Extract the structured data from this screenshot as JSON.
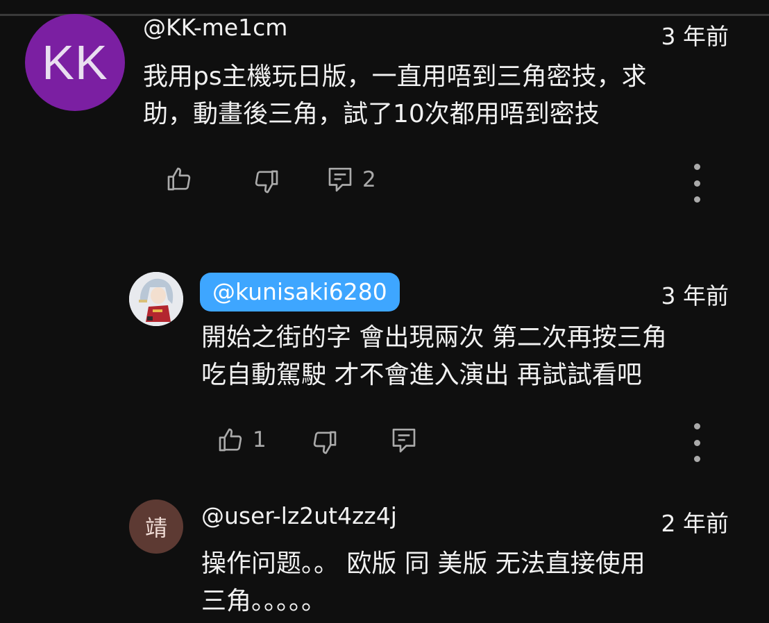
{
  "comments": [
    {
      "avatar_text": "KK",
      "avatar_color": "#7b1fa2",
      "author": "@KK-me1cm",
      "time": "3 年前",
      "lines": [
        "我用ps主機玩日版，一直用唔到三角密技，求",
        "助，動畫後三角，試了10次都用唔到密技"
      ],
      "reply_count": "2"
    },
    {
      "avatar_icon": "anime-character-avatar",
      "author": "@kunisaki6280",
      "author_highlight_color": "#3ea6ff",
      "time": "3 年前",
      "lines": [
        "開始之街的字 會出現兩次 第二次再按三角",
        "吃自動駕駛 才不會進入演出 再試試看吧"
      ],
      "like_count": "1"
    },
    {
      "avatar_text": "靖",
      "avatar_color": "#5d3a33",
      "author": "@user-lz2ut4zz4j",
      "time": "2 年前",
      "lines": [
        "操作问题。。 欧版 同 美版 无法直接使用",
        "三角。。。。。"
      ]
    }
  ],
  "icons": {
    "like": "thumb-up-icon",
    "dislike": "thumb-down-icon",
    "reply": "reply-comment-icon",
    "more": "more-vert-icon"
  }
}
